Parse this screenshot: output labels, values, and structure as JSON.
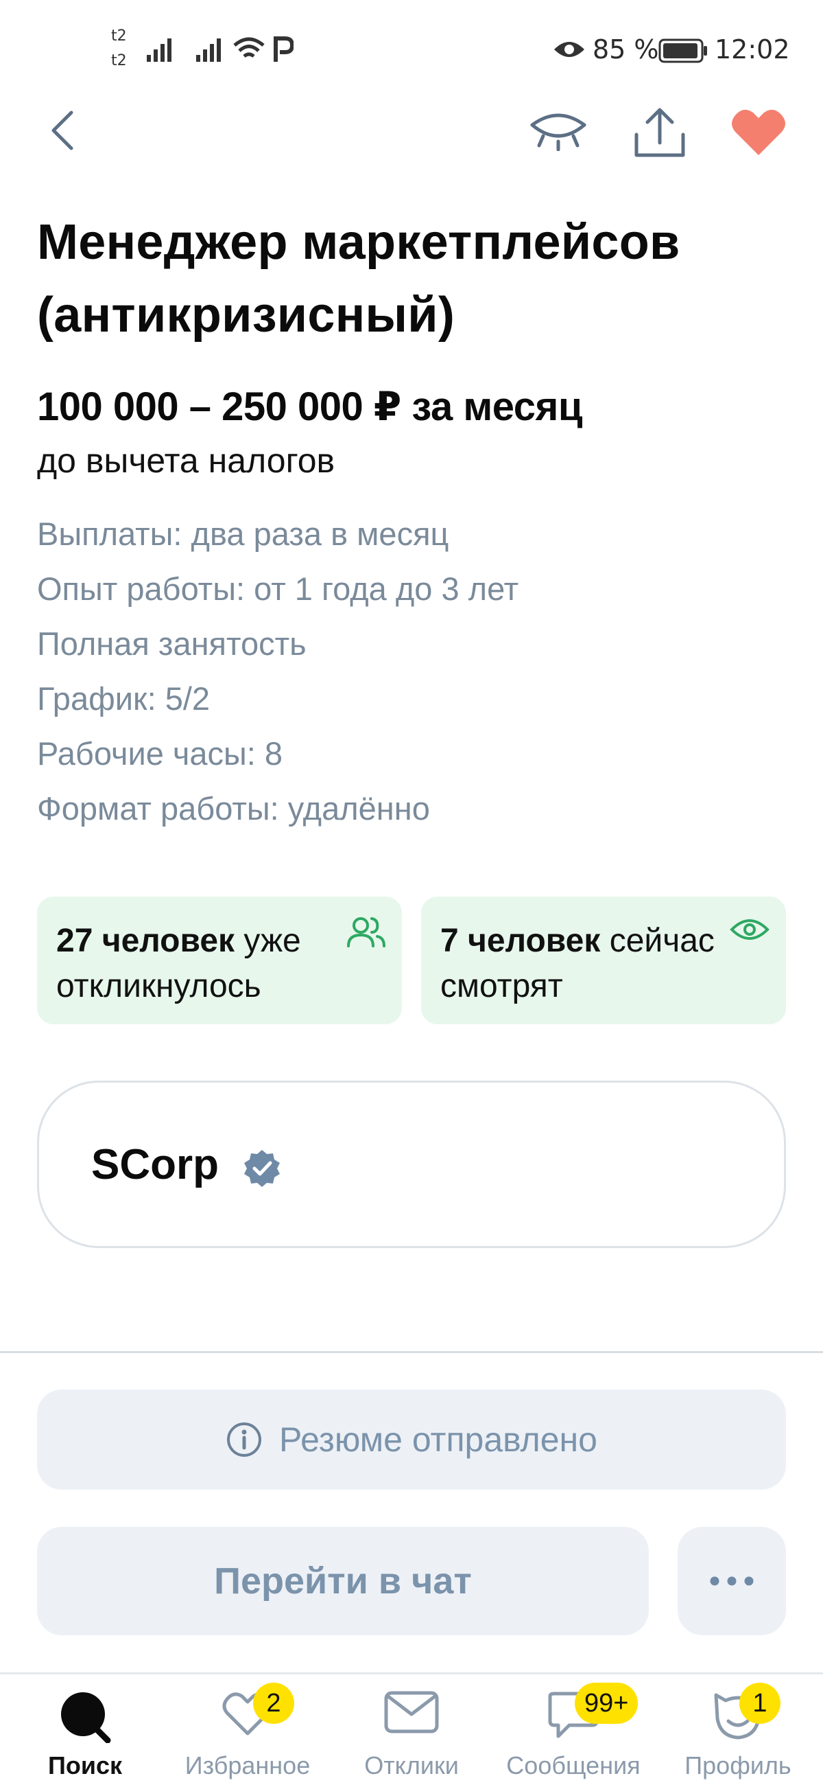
{
  "status_bar": {
    "carrier1": "t2",
    "carrier2": "t2",
    "battery": "85 %",
    "time": "12:02"
  },
  "header": {
    "back_icon": "chevron-left-icon",
    "hide_icon": "eye-closed-icon",
    "share_icon": "share-icon",
    "favorite_icon": "heart-icon",
    "favorite_color": "#f47f6e"
  },
  "vacancy": {
    "title_line1": "Менеджер маркетплейсов",
    "title_line2": "(антикризисный)",
    "salary": "100 000 – 250 000 ₽ за месяц",
    "tax_note": "до вычета налогов",
    "details": [
      "Выплаты: два раза в месяц",
      "Опыт работы: от 1 года до 3 лет",
      "Полная занятость",
      "График: 5/2",
      "Рабочие часы: 8",
      "Формат работы: удалённо"
    ]
  },
  "stats": {
    "responded_count": "27 человек",
    "responded_text": " уже откликнулось",
    "viewing_count": "7 человек",
    "viewing_text": " сейчас смотрят",
    "accent": "#2ea862"
  },
  "company": {
    "name": "SCorp",
    "verified_icon": "verified-badge-icon"
  },
  "actions": {
    "resume_sent": "Резюме отправлено",
    "go_to_chat": "Перейти в чат",
    "more": "more-dots-icon"
  },
  "tabbar": {
    "items": [
      {
        "label": "Поиск",
        "icon": "search-icon",
        "active": true
      },
      {
        "label": "Избранное",
        "icon": "heart-outline-icon",
        "badge": "2"
      },
      {
        "label": "Отклики",
        "icon": "envelope-icon"
      },
      {
        "label": "Сообщения",
        "icon": "chat-bubble-icon",
        "badge": "99+"
      },
      {
        "label": "Профиль",
        "icon": "profile-icon",
        "badge": "1"
      }
    ]
  }
}
